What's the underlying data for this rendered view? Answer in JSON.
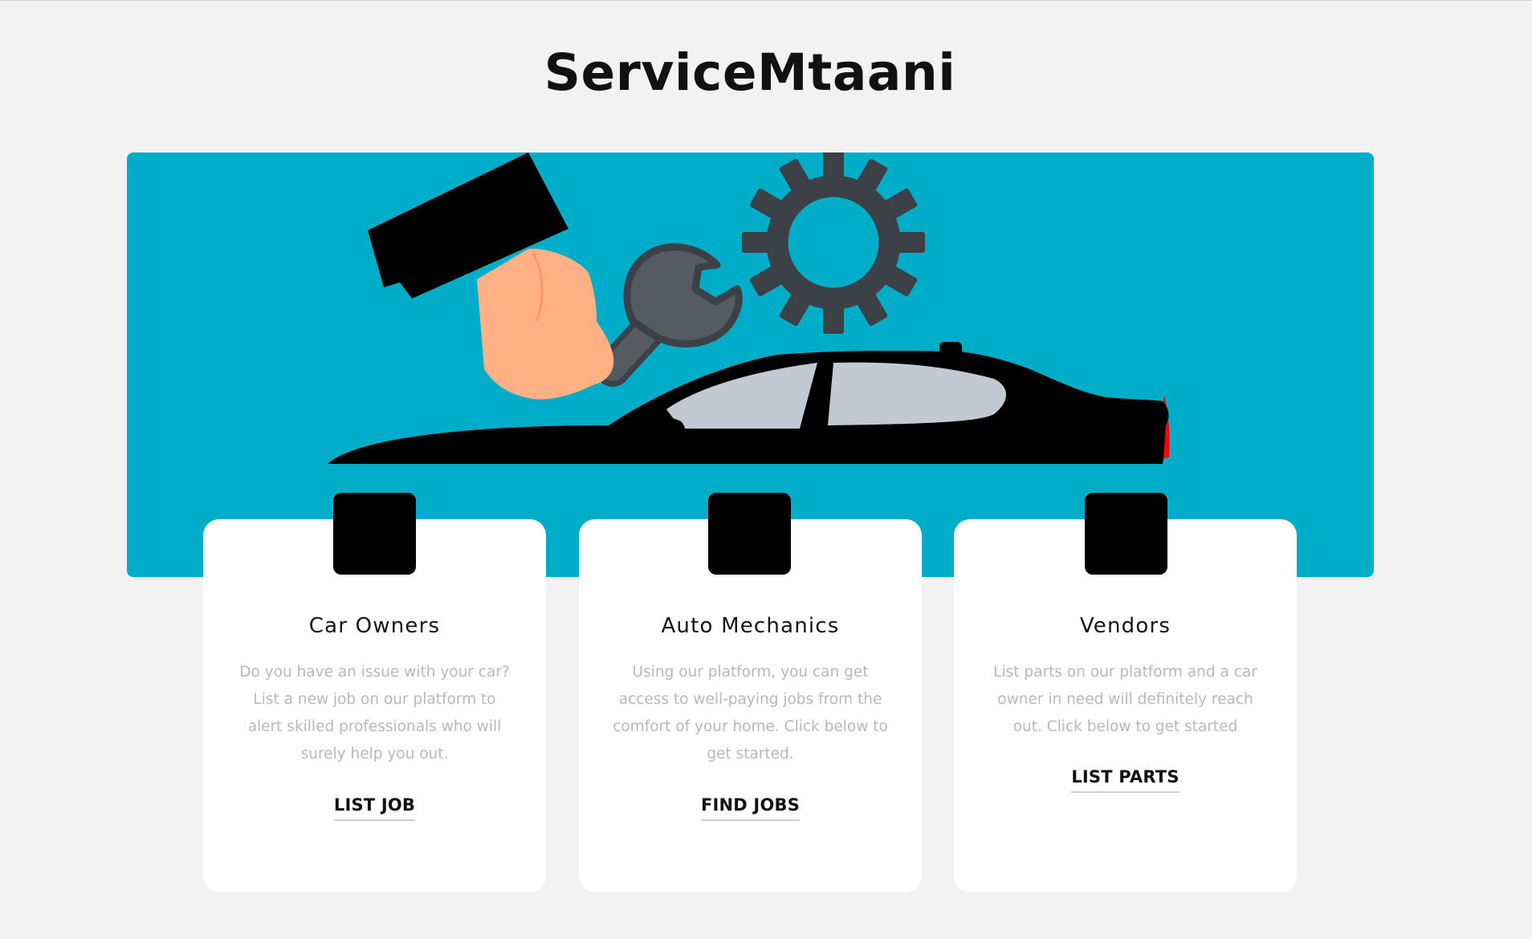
{
  "header": {
    "title": "ServiceMtaani"
  },
  "hero": {
    "illustration": "mechanic-hand-wrench-gear-car",
    "colors": {
      "background": "#00adc9",
      "gear": "#3c4148",
      "wrench": "#555b62",
      "hand": "#ffb085",
      "sleeve": "#000000",
      "car_body": "#000000",
      "car_windows": "#c1cad3",
      "tail_light": "#ff0000"
    }
  },
  "cards": [
    {
      "title": "Car Owners",
      "description": "Do you have an issue with your car? List a new job on our platform to alert skilled professionals who will surely help you out.",
      "link_label": "LIST JOB"
    },
    {
      "title": "Auto Mechanics",
      "description": "Using our platform, you can get access to well-paying jobs from the comfort of your home. Click below to get started.",
      "link_label": "FIND JOBS"
    },
    {
      "title": "Vendors",
      "description": "List parts on our platform and a car owner in need will definitely reach out. Click below to get started",
      "link_label": "LIST PARTS"
    }
  ]
}
